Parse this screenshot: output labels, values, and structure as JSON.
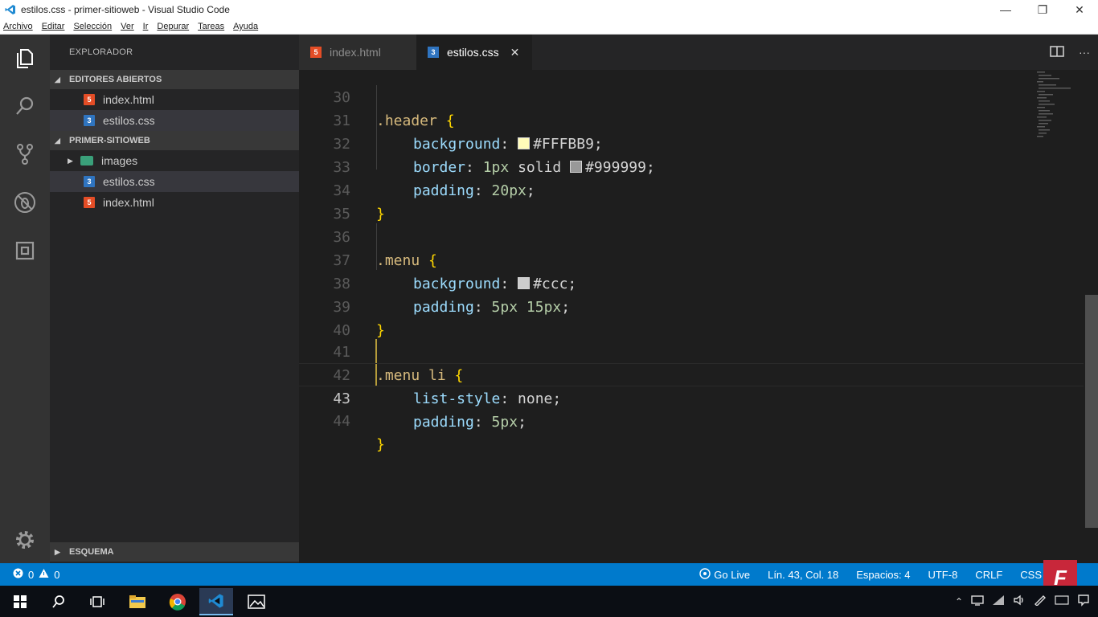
{
  "window": {
    "title": "estilos.css - primer-sitioweb - Visual Studio Code",
    "minimize": "—",
    "maximize": "❐",
    "close": "✕"
  },
  "menu": [
    "Archivo",
    "Editar",
    "Selección",
    "Ver",
    "Ir",
    "Depurar",
    "Tareas",
    "Ayuda"
  ],
  "sidebar": {
    "title": "EXPLORADOR",
    "open_editors": {
      "label": "EDITORES ABIERTOS",
      "files": [
        {
          "name": "index.html",
          "type": "html"
        },
        {
          "name": "estilos.css",
          "type": "css",
          "selected": true
        }
      ]
    },
    "project": {
      "label": "PRIMER-SITIOWEB",
      "items": [
        {
          "name": "images",
          "type": "folder"
        },
        {
          "name": "estilos.css",
          "type": "css",
          "selected": true
        },
        {
          "name": "index.html",
          "type": "html"
        }
      ]
    },
    "outline": {
      "label": "ESQUEMA"
    }
  },
  "tabs": [
    {
      "label": "index.html",
      "type": "html",
      "active": false
    },
    {
      "label": "estilos.css",
      "type": "css",
      "active": true
    }
  ],
  "tab_close": "✕",
  "tab_more": "···",
  "file_badges": {
    "html": "5",
    "css": "3"
  },
  "editor": {
    "lines": [
      {
        "num": "30",
        "text": ".header {"
      },
      {
        "num": "31",
        "text": "background: #FFFBB9;"
      },
      {
        "num": "32",
        "text": "border: 1px solid #999999;"
      },
      {
        "num": "33",
        "text": "padding: 20px;"
      },
      {
        "num": "34",
        "text": "}"
      },
      {
        "num": "35",
        "text": ""
      },
      {
        "num": "36",
        "text": ".menu {"
      },
      {
        "num": "37",
        "text": "background: #ccc;"
      },
      {
        "num": "38",
        "text": "padding: 5px 15px;"
      },
      {
        "num": "39",
        "text": "}"
      },
      {
        "num": "40",
        "text": ""
      },
      {
        "num": "41",
        "text": ".menu li {"
      },
      {
        "num": "42",
        "text": "list-style: none;"
      },
      {
        "num": "43",
        "text": "padding: 5px;",
        "current": true
      },
      {
        "num": "44",
        "text": "}"
      }
    ],
    "swatches": {
      "header_bg": "#FFFBB9",
      "header_border": "#999999",
      "menu_bg": "#cccccc"
    }
  },
  "statusbar": {
    "errors": "0",
    "warnings": "0",
    "go_live": "Go Live",
    "position": "Lín. 43, Col. 18",
    "spaces": "Espacios: 4",
    "encoding": "UTF-8",
    "eol": "CRLF",
    "language": "CSS",
    "logo": "F"
  },
  "colors": {
    "accent": "#007acc",
    "selector": "#d7ba7d",
    "property": "#9cdcfe",
    "number": "#b5cea8",
    "brace": "#ffd700"
  }
}
